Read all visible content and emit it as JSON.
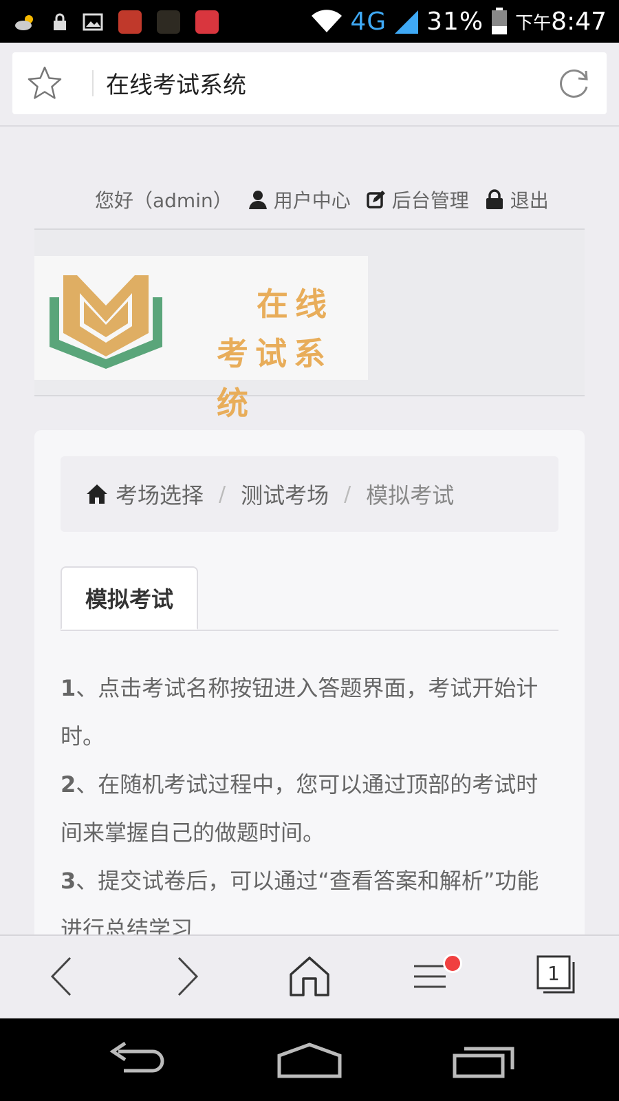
{
  "status_bar": {
    "network": "4G",
    "battery": "31%",
    "time_prefix": "下午",
    "time": "8:47"
  },
  "browser": {
    "page_title": "在线考试系统"
  },
  "userbar": {
    "greeting": "您好（admin）",
    "user_center": "用户中心",
    "admin_panel": "后台管理",
    "logout": "退出"
  },
  "logo": {
    "line1": "在线",
    "line2": "考试系统"
  },
  "breadcrumb": {
    "home": "考场选择",
    "level2": "测试考场",
    "current": "模拟考试",
    "separator": "/"
  },
  "tabs": {
    "active": "模拟考试"
  },
  "instructions": [
    {
      "num": "1",
      "text": "、点击考试名称按钮进入答题界面，考试开始计时。"
    },
    {
      "num": "2",
      "text": "、在随机考试过程中，您可以通过顶部的考试时间来掌握自己的做题时间。"
    },
    {
      "num": "3",
      "text": "、提交试卷后，可以通过“查看答案和解析”功能进行总结学习"
    }
  ],
  "toolbar": {
    "tabs_count": "1"
  },
  "colors": {
    "logo_gold": "#e8ad5a",
    "logo_green": "#5aa57a",
    "notify_red": "#f04040"
  }
}
